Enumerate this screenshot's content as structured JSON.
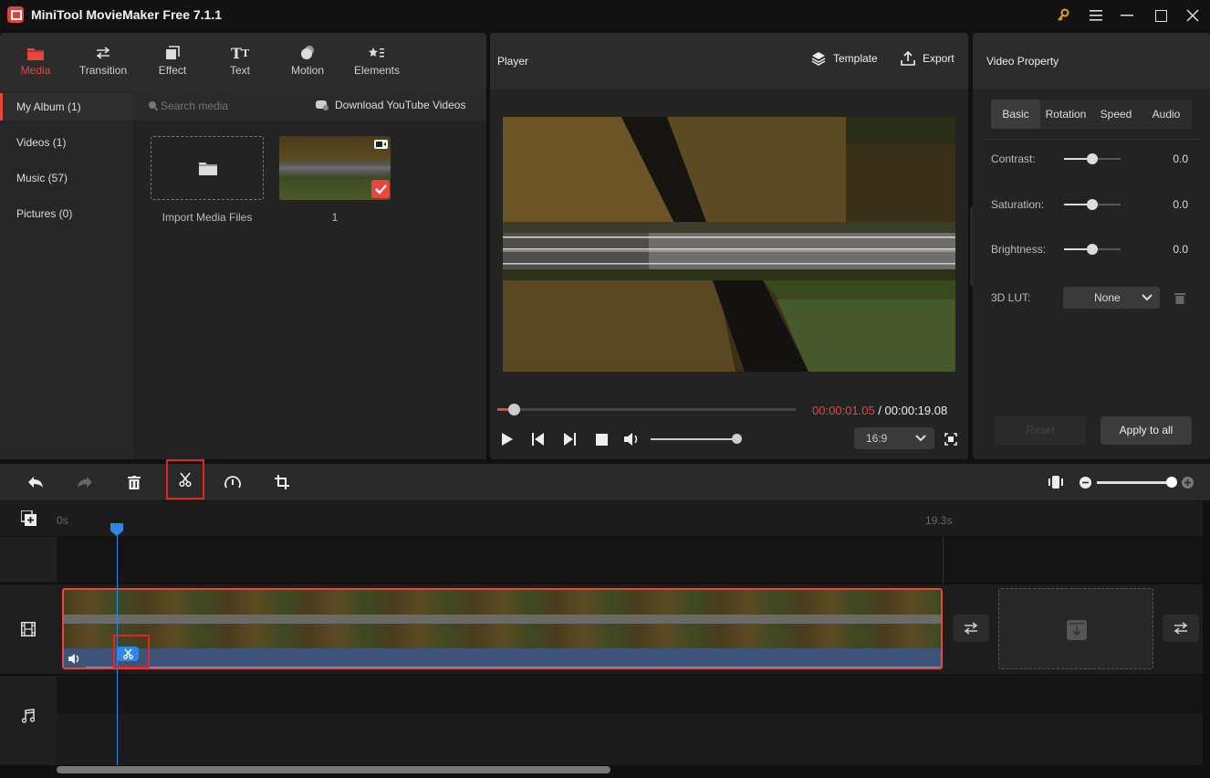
{
  "app": {
    "title": "MiniTool MovieMaker Free 7.1.1"
  },
  "window_controls": {
    "key": "upgrade-key",
    "menu": "menu",
    "minimize": "minimize",
    "maximize": "maximize",
    "close": "close"
  },
  "media_tabs": [
    {
      "label": "Media",
      "icon": "folder-icon",
      "active": true
    },
    {
      "label": "Transition",
      "icon": "transition-icon"
    },
    {
      "label": "Effect",
      "icon": "effect-icon"
    },
    {
      "label": "Text",
      "icon": "text-icon"
    },
    {
      "label": "Motion",
      "icon": "motion-icon"
    },
    {
      "label": "Elements",
      "icon": "elements-icon"
    }
  ],
  "album": [
    {
      "label": "My Album (1)",
      "active": true
    },
    {
      "label": "Videos (1)"
    },
    {
      "label": "Music (57)"
    },
    {
      "label": "Pictures (0)"
    }
  ],
  "media": {
    "search_placeholder": "Search media",
    "download_label": "Download YouTube Videos",
    "import_label": "Import Media Files",
    "items": [
      {
        "label": "1",
        "type": "video",
        "selected": true
      }
    ]
  },
  "player": {
    "title": "Player",
    "template_label": "Template",
    "export_label": "Export",
    "current_time": "00:00:01.05",
    "separator": " / ",
    "total_time": "00:00:19.08",
    "progress": 0.055,
    "volume": 1.0,
    "aspect_ratio": "16:9"
  },
  "property": {
    "title": "Video Property",
    "tabs": [
      "Basic",
      "Rotation",
      "Speed",
      "Audio"
    ],
    "active_tab": "Basic",
    "rows": [
      {
        "label": "Contrast:",
        "value": "0.0",
        "level": 0.5
      },
      {
        "label": "Saturation:",
        "value": "0.0",
        "level": 0.5
      },
      {
        "label": "Brightness:",
        "value": "0.0",
        "level": 0.5
      }
    ],
    "lut_label": "3D LUT:",
    "lut_value": "None",
    "reset_label": "Reset",
    "apply_label": "Apply to all"
  },
  "timeline": {
    "ruler_start": "0s",
    "ruler_end": "19.3s",
    "zoom_level": 1.0,
    "colors": {
      "accent": "#e8453c",
      "playhead": "#2e86e8",
      "highlight": "#e5261e"
    }
  }
}
